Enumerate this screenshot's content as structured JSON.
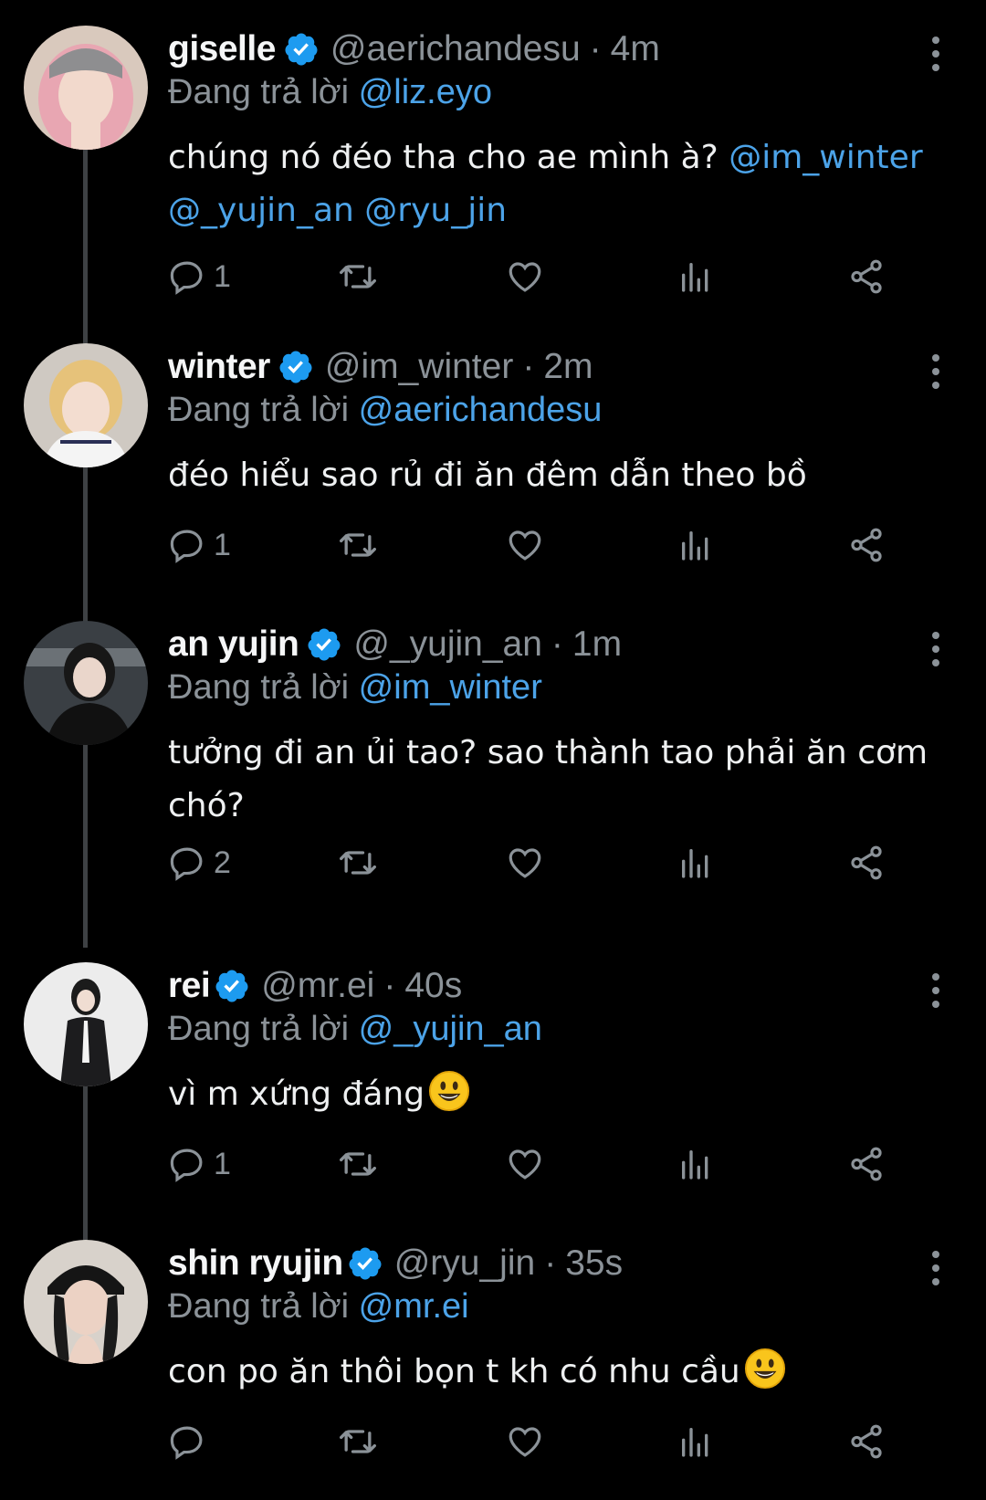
{
  "replying_label": "Đang trả lời",
  "colors": {
    "background": "#000000",
    "mention": "#4ca3e8",
    "muted": "#8b9298",
    "verified": "#1d9bf0"
  },
  "tweets": [
    {
      "name": "giselle",
      "handle": "@aerichandesu",
      "time": "4m",
      "reply_to": "@liz.eyo",
      "text_parts": [
        {
          "t": "chúng nó đéo tha cho ae mình à? ",
          "mention": false
        },
        {
          "t": "@im_winter",
          "mention": true
        },
        {
          "t": " ",
          "mention": false
        },
        {
          "t": "@_yujin_an",
          "mention": true
        },
        {
          "t": " ",
          "mention": false
        },
        {
          "t": "@ryu_jin",
          "mention": true
        }
      ],
      "replies": "1",
      "avatar": "avatar-giselle"
    },
    {
      "name": "winter",
      "handle": "@im_winter",
      "time": "2m",
      "reply_to": "@aerichandesu",
      "text_parts": [
        {
          "t": "đéo hiểu sao rủ đi ăn đêm dẫn theo bồ",
          "mention": false
        }
      ],
      "replies": "1",
      "avatar": "avatar-winter"
    },
    {
      "name": "an yujin",
      "handle": "@_yujin_an",
      "time": "1m",
      "reply_to": "@im_winter",
      "text_parts": [
        {
          "t": "tưởng đi an ủi tao? sao thành tao phải ăn cơm chó?",
          "mention": false
        }
      ],
      "replies": "2",
      "avatar": "avatar-anyujin"
    },
    {
      "name": "rei",
      "handle": "@mr.ei",
      "time": "40s",
      "reply_to": "@_yujin_an",
      "text_parts": [
        {
          "t": "vì m xứng đáng",
          "mention": false
        }
      ],
      "emoji": "smiley-emoji",
      "replies": "1",
      "avatar": "avatar-rei"
    },
    {
      "name": "shin ryujin",
      "handle": "@ryu_jin",
      "time": "35s",
      "reply_to": "@mr.ei",
      "text_parts": [
        {
          "t": "con po ăn thôi bọn t kh có nhu cầu",
          "mention": false
        }
      ],
      "emoji": "smiley-emoji",
      "replies": "",
      "avatar": "avatar-ryujin"
    }
  ],
  "icons": [
    "reply-icon",
    "retweet-icon",
    "like-icon",
    "views-icon",
    "share-icon",
    "more-options-icon",
    "verified-badge-icon"
  ]
}
